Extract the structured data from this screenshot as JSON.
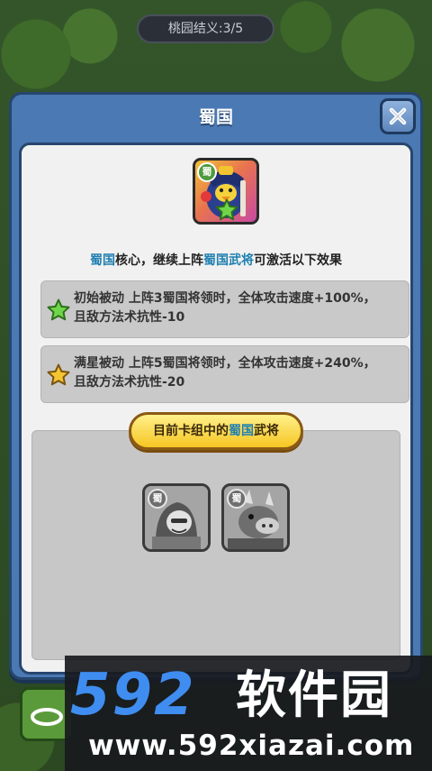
{
  "hud": {
    "progress_label": "桃园结义:3/5"
  },
  "modal": {
    "title": "蜀国",
    "close_icon": "close-x-icon",
    "hero": {
      "faction_tag": "蜀",
      "star_icon": "green-star-icon"
    },
    "description": {
      "part1": "蜀国",
      "part2": "核心，继续上阵",
      "part3": "蜀国武将",
      "part4": "可激活以下效果"
    },
    "effects": [
      {
        "icon": "green-star-icon",
        "line1": "初始被动 上阵3蜀国将领时，全体攻击速度+100%，",
        "line2": "且敌方法术抗性-10"
      },
      {
        "icon": "gold-star-icon",
        "line1": "满星被动 上阵5蜀国将领时，全体攻击速度+240%，",
        "line2": "且敌方法术抗性-20"
      }
    ],
    "deck": {
      "banner_prefix": "目前卡组中的",
      "banner_highlight": "蜀国",
      "banner_suffix": "武将",
      "members": [
        {
          "faction_tag": "蜀",
          "portrait": "long-haired-warrior-portrait"
        },
        {
          "faction_tag": "蜀",
          "portrait": "horned-beast-warrior-portrait"
        }
      ]
    }
  },
  "watermark": {
    "logo_number": "592",
    "logo_text": "软件园",
    "url": "www.592xiazai.com"
  },
  "colors": {
    "modal_frame": "#4a79b3",
    "highlight_text": "#1e7fb0",
    "banner_gold": "#f6c623"
  }
}
